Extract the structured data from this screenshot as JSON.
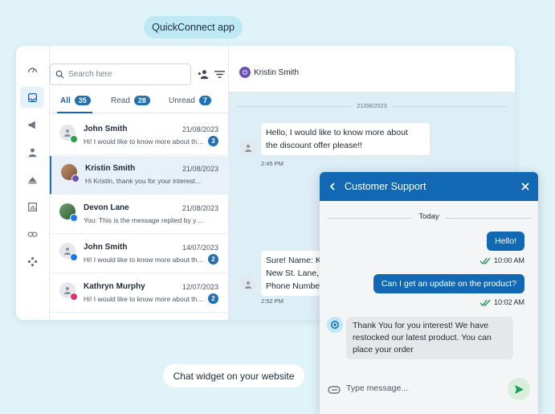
{
  "labels": {
    "top": "QuickConnect app",
    "bottom": "Chat widget on your website"
  },
  "rail": [
    "dashboard-icon",
    "inbox-icon",
    "megaphone-icon",
    "contact-icon",
    "ship-icon",
    "reports-icon",
    "link-icon",
    "network-icon"
  ],
  "search": {
    "placeholder": "Search here"
  },
  "tabs": [
    {
      "label": "All",
      "count": "35"
    },
    {
      "label": "Read",
      "count": "28"
    },
    {
      "label": "Unread",
      "count": "7"
    }
  ],
  "conversations": [
    {
      "name": "John Smith",
      "date": "21/08/2023",
      "snippet": "Hi! I would like to know more about the discount offer please!!",
      "unread": "3",
      "channel": "whatsapp"
    },
    {
      "name": "Kristin Smith",
      "date": "21/08/2023",
      "snippet": "Hi Kristin, thank you for your interest...",
      "unread": "",
      "channel": "viber"
    },
    {
      "name": "Devon Lane",
      "date": "21/08/2023",
      "snippet": "You: This is the message replied by yours...",
      "unread": "",
      "channel": "facebook"
    },
    {
      "name": "John Smith",
      "date": "14/07/2023",
      "snippet": "Hi! I would like to know more about the discount offer please!!",
      "unread": "2",
      "channel": "facebook"
    },
    {
      "name": "Kathryn Murphy",
      "date": "12/07/2023",
      "snippet": "Hi! I would like to know more about the discount offer please!!",
      "unread": "2",
      "channel": "instagram"
    }
  ],
  "chat": {
    "contact_name": "Kristin Smith",
    "date": "21/08/2023",
    "messages": [
      {
        "text": "Hello, I would like to know more about the discount offer please!!",
        "line1": "Hello, I would like to know more about",
        "line2": "the discount offer please!!",
        "time": "2:45 PM"
      },
      {
        "line1": "Sure! Name: K",
        "line2": "New St. Lane,",
        "line3": "Phone Numbe",
        "time": "2:52 PM"
      }
    ]
  },
  "widget": {
    "title": "Customer Support",
    "today": "Today",
    "outgoing": [
      {
        "text": "Hello!",
        "time": "10:00 AM"
      },
      {
        "text": "Can I get an update on the product?",
        "time": "10:02 AM"
      }
    ],
    "incoming": "Thank You for you interest! We have restocked our latest product. You can place your order",
    "input_placeholder": "Type message..."
  },
  "colors": {
    "primary": "#1368b4",
    "background": "#dff3f9",
    "chat_bg": "#deeef7",
    "read_tick": "#1f9d55"
  }
}
